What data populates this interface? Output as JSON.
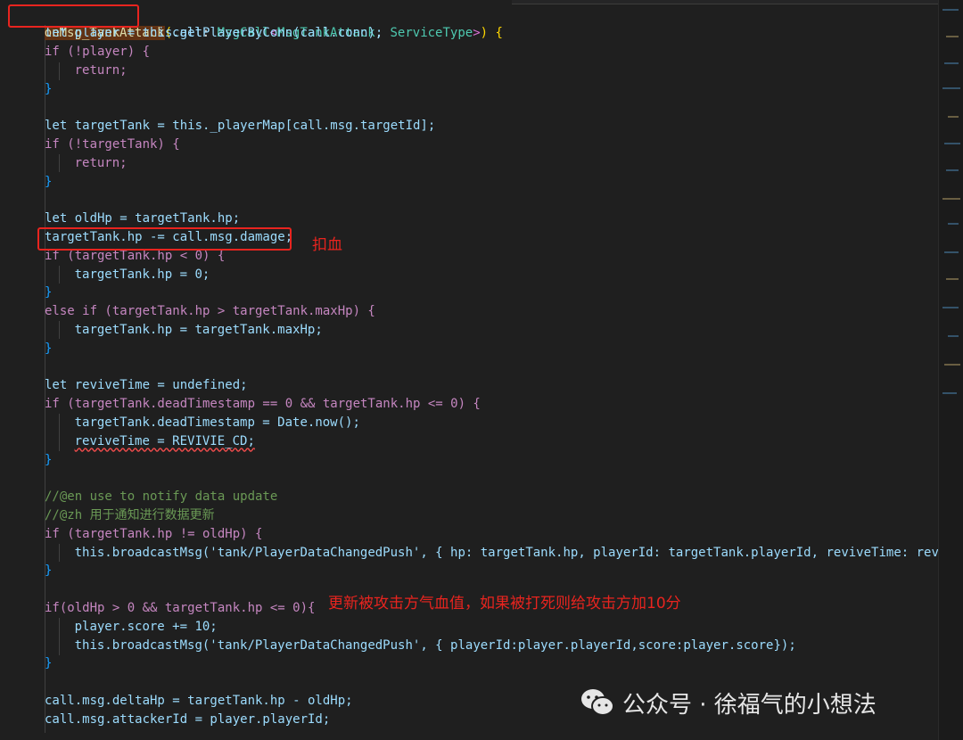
{
  "code": {
    "line_01_name": "onMsg_TankAttack",
    "line_01_p": "(",
    "line_01_a": "call",
    "line_01_b": ": ",
    "line_01_t1": "MsgCall",
    "line_01_lt": "<",
    "line_01_t2": "MsgTankAttack",
    "line_01_c": ", ",
    "line_01_t3": "ServiceType",
    "line_01_gt": ">",
    "line_01_p2": ") ",
    "line_01_ob": "{",
    "line_02": "let player = this.getPlayerByConn(call.conn);",
    "line_03": "if (!player) {",
    "line_04": "return;",
    "line_05": "}",
    "line_07": "let targetTank = this._playerMap[call.msg.targetId];",
    "line_08": "if (!targetTank) {",
    "line_09": "return;",
    "line_10": "}",
    "line_12": "let oldHp = targetTank.hp;",
    "line_13": "targetTank.hp -= call.msg.damage;",
    "line_14": "if (targetTank.hp < 0) {",
    "line_15": "targetTank.hp = 0;",
    "line_16": "}",
    "line_17": "else if (targetTank.hp > targetTank.maxHp) {",
    "line_18": "targetTank.hp = targetTank.maxHp;",
    "line_19": "}",
    "line_21": "let reviveTime = undefined;",
    "line_22": "if (targetTank.deadTimestamp == 0 && targetTank.hp <= 0) {",
    "line_23": "targetTank.deadTimestamp = Date.now();",
    "line_24": "reviveTime = REVIVIE_CD;",
    "line_25": "}",
    "line_27": "//@en use to notify data update",
    "line_28": "//@zh 用于通知进行数据更新",
    "line_29": "if (targetTank.hp != oldHp) {",
    "line_30": "this.broadcastMsg('tank/PlayerDataChangedPush', { hp: targetTank.hp, playerId: targetTank.playerId, reviveTime: rev",
    "line_31": "}",
    "line_33": "if(oldHp > 0 && targetTank.hp <= 0){",
    "line_34": "player.score += 10;",
    "line_35": "this.broadcastMsg('tank/PlayerDataChangedPush', { playerId:player.playerId,score:player.score});",
    "line_36": "}",
    "line_38": "call.msg.deltaHp = targetTank.hp - oldHp;",
    "line_39": "call.msg.attackerId = player.playerId;"
  },
  "annotations": {
    "damage_note": "扣血",
    "score_note": "更新被攻击方气血值，如果被打死则给攻击方加10分"
  },
  "watermark": {
    "icon": "wechat-icon",
    "text": "公众号 · 徐福气的小想法"
  },
  "colors": {
    "background": "#1f1f1f",
    "keyword": "#569cd6",
    "function": "#dcdcaa",
    "variable": "#9cdcfe",
    "type": "#4ec9b0",
    "string": "#ce9178",
    "comment": "#6a9955",
    "annotation_red": "#e8241f"
  }
}
